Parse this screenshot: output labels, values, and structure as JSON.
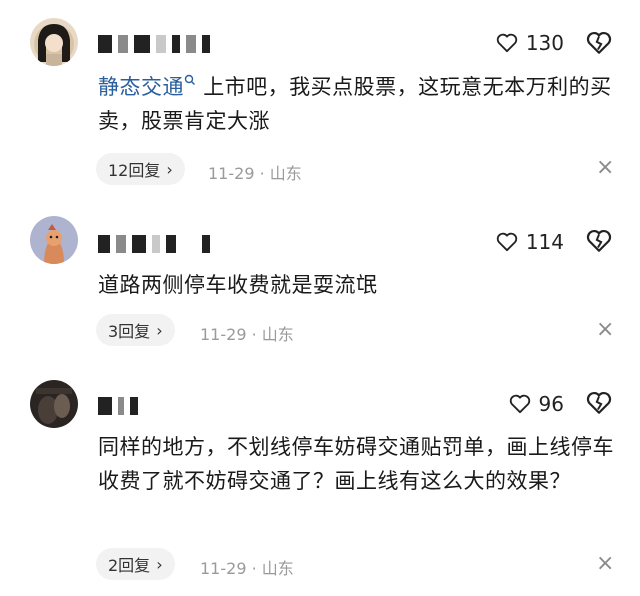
{
  "comments": [
    {
      "likes": "130",
      "mention": "静态交通",
      "text": "上市吧，我买点股票，这玩意无本万利的买卖，股票肯定大涨",
      "replies": "12回复",
      "date": "11-29",
      "location": "山东"
    },
    {
      "likes": "114",
      "text": "道路两侧停车收费就是耍流氓",
      "replies": "3回复",
      "date": "11-29",
      "location": "山东"
    },
    {
      "likes": "96",
      "text": "同样的地方，不划线停车妨碍交通贴罚单，画上线停车收费了就不妨碍交通了？画上线有这么大的效果？",
      "replies": "2回复",
      "date": "11-29",
      "location": "山东"
    }
  ],
  "icons": {
    "like": "heart-outline-icon",
    "dislike": "broken-heart-icon",
    "search": "search-icon",
    "chevron": "chevron-right-icon",
    "close": "close-icon"
  },
  "colors": {
    "mention": "#2a5f9e",
    "meta": "#9a9a9a",
    "reply_bg": "#f2f2f2"
  },
  "separator": "·",
  "chevron": "›",
  "close_glyph": "×"
}
